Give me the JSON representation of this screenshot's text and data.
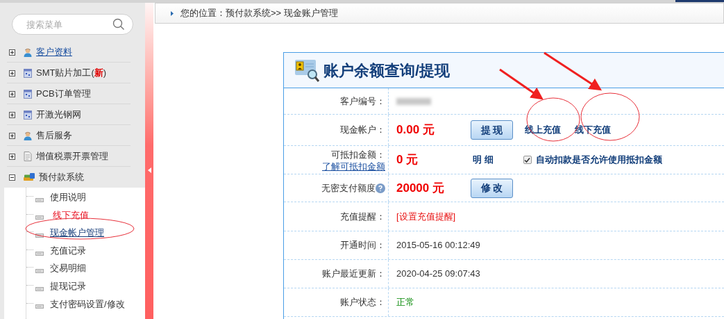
{
  "sidebar": {
    "search": {
      "placeholder": "搜索菜单"
    },
    "items": [
      {
        "label": "客户资料",
        "kind": "link",
        "expanded": false
      },
      {
        "label": "SMT贴片加工(",
        "badge": "新",
        "suffix": ")",
        "kind": "plain",
        "expanded": false
      },
      {
        "label": "PCB订单管理",
        "kind": "plain",
        "expanded": false
      },
      {
        "label": "开激光钢网",
        "kind": "plain",
        "expanded": false
      },
      {
        "label": "售后服务",
        "kind": "plain",
        "expanded": false
      },
      {
        "label": "增值税票开票管理",
        "kind": "plain",
        "expanded": false
      },
      {
        "label": "预付款系统",
        "kind": "plain",
        "expanded": true,
        "children": [
          {
            "label": "使用说明",
            "kind": "plain",
            "selected": false
          },
          {
            "label": "线下充值",
            "kind": "alert",
            "selected": false
          },
          {
            "label": "现金帐户管理",
            "kind": "plain",
            "selected": true
          },
          {
            "label": "充值记录",
            "kind": "plain",
            "selected": false
          },
          {
            "label": "交易明细",
            "kind": "plain",
            "selected": false
          },
          {
            "label": "提现记录",
            "kind": "plain",
            "selected": false
          },
          {
            "label": "支付密码设置/修改",
            "kind": "plain",
            "selected": false
          }
        ]
      }
    ]
  },
  "breadcrumb": "您的位置：预付款系统>> 现金账户管理",
  "panel": {
    "title": "账户余额查询/提现",
    "rows": [
      {
        "label": "客户编号：",
        "kind": "redacted"
      },
      {
        "label": "现金帐户：",
        "kind": "amount",
        "amount": "0.00 元",
        "button": "提 现",
        "links": [
          "线上充值",
          "线下充值"
        ]
      },
      {
        "label": "可抵扣金额：",
        "sublink": "了解可抵扣金额",
        "kind": "amount",
        "amount": "0 元",
        "links": [
          "明 细"
        ],
        "checkbox": {
          "label": "自动扣款是否允许使用抵扣金额",
          "checked": true
        }
      },
      {
        "label": "无密支付额度",
        "help": true,
        "kind": "amount",
        "amount": "20000 元",
        "button": "修 改"
      },
      {
        "label": "充值提醒：",
        "kind": "alert-link",
        "value": "[设置充值提醒]"
      },
      {
        "label": "开通时间：",
        "kind": "text",
        "value": "2015-05-16 00:12:49"
      },
      {
        "label": "账户最近更新：",
        "kind": "text",
        "value": "2020-04-25 09:07:43"
      },
      {
        "label": "账户状态：",
        "kind": "status",
        "value": "正常"
      }
    ]
  }
}
